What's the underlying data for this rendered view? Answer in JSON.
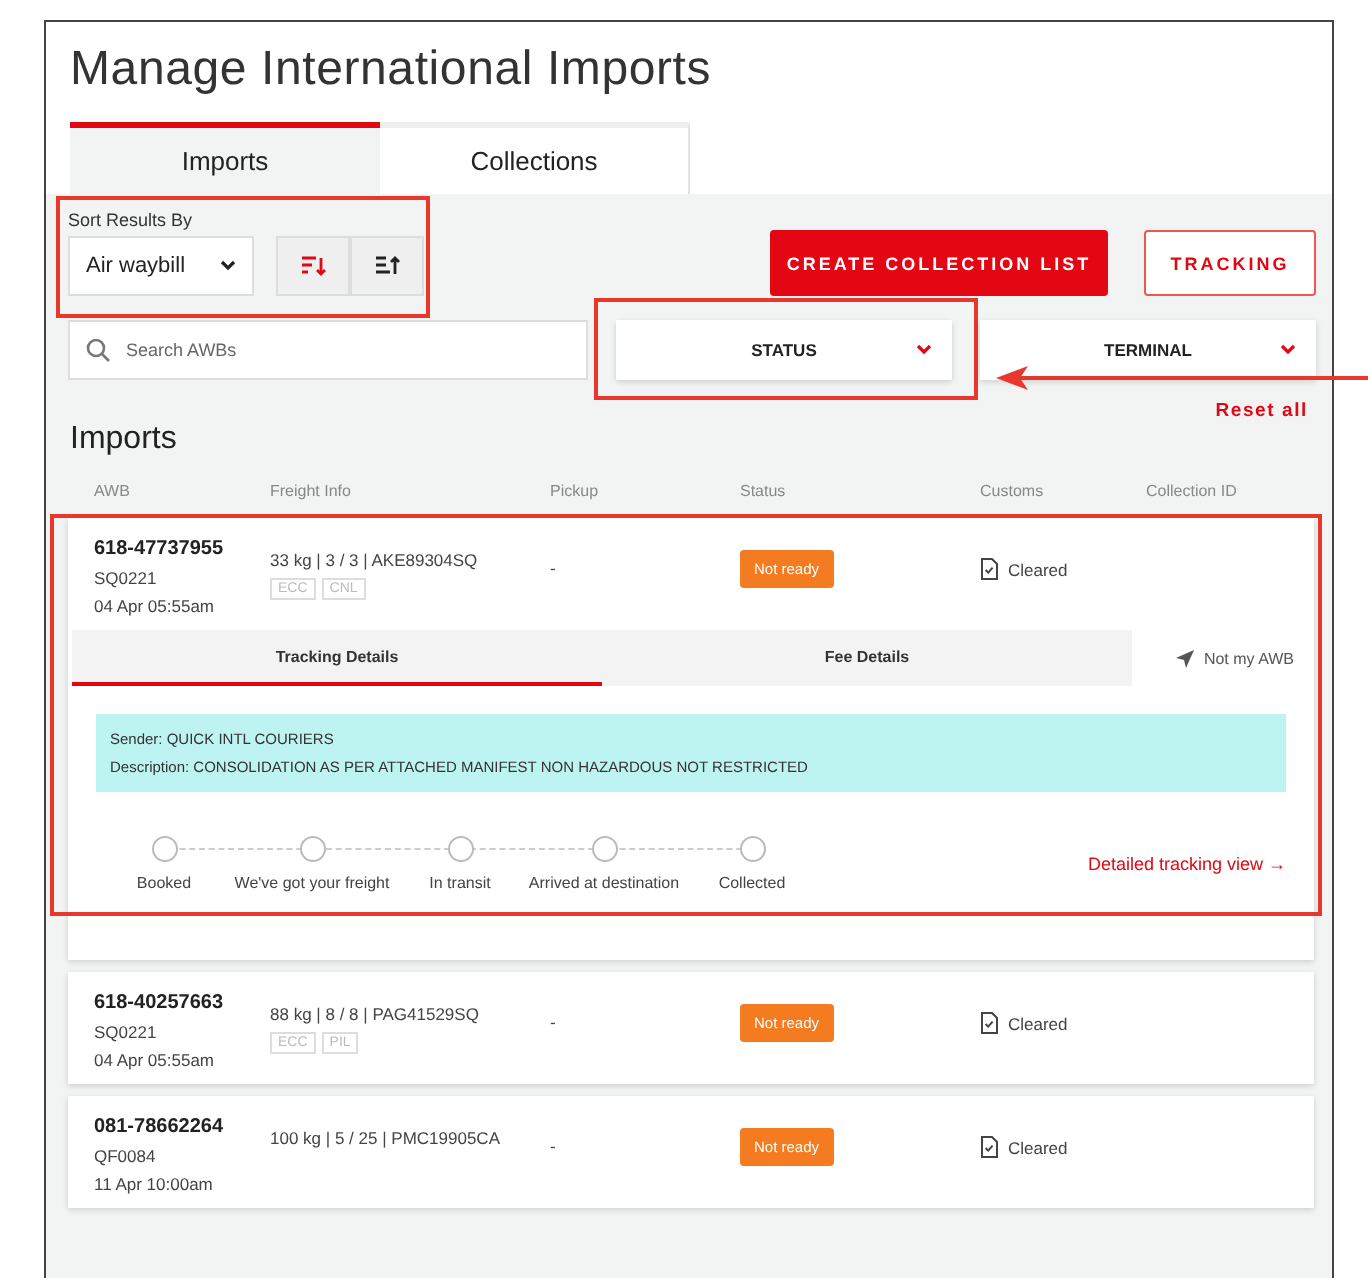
{
  "title": "Manage International Imports",
  "tabs": [
    {
      "label": "Imports",
      "selected": true
    },
    {
      "label": "Collections",
      "selected": false
    }
  ],
  "sort": {
    "label": "Sort Results By",
    "value": "Air waybill",
    "highlighted": true,
    "descending": true
  },
  "actions": [
    {
      "label": "CREATE COLLECTION LIST",
      "kind": "primary"
    },
    {
      "label": "TRACKING",
      "kind": "outline"
    }
  ],
  "search": {
    "placeholder": "Search AWBs"
  },
  "filters": [
    {
      "label": "STATUS",
      "highlighted": true
    },
    {
      "label": "TERMINAL",
      "highlighted": false
    }
  ],
  "reset": "Reset all",
  "section_title": "Imports",
  "columns": [
    "AWB",
    "Freight Info",
    "Pickup",
    "Status",
    "Customs",
    "Collection ID"
  ],
  "rows": [
    {
      "awb": "618-47737955",
      "flight": "SQ0221",
      "date": "04 Apr 05:55am",
      "freight": "33 kg | 3 / 3 | AKE89304SQ",
      "tags": [
        "ECC",
        "CNL"
      ],
      "pickup": "-",
      "status": "Not ready",
      "customs": "Cleared",
      "expanded": true,
      "highlighted": true,
      "detail_tabs": [
        {
          "label": "Tracking Details",
          "selected": true
        },
        {
          "label": "Fee Details",
          "selected": false
        }
      ],
      "not_my_awb": "Not my AWB",
      "sender": "Sender: QUICK INTL COURIERS",
      "description": "Description: CONSOLIDATION AS PER ATTACHED MANIFEST NON HAZARDOUS NOT RESTRICTED",
      "steps": [
        "Booked",
        "We've got your freight",
        "In transit",
        "Arrived at destination",
        "Collected"
      ],
      "tracking_link": "Detailed tracking view →"
    },
    {
      "awb": "618-40257663",
      "flight": "SQ0221",
      "date": "04 Apr 05:55am",
      "freight": "88 kg | 8 / 8 | PAG41529SQ",
      "tags": [
        "ECC",
        "PIL"
      ],
      "pickup": "-",
      "status": "Not ready",
      "customs": "Cleared",
      "expanded": false,
      "highlighted": false
    },
    {
      "awb": "081-78662264",
      "flight": "QF0084",
      "date": "11 Apr 10:00am",
      "freight": "100 kg | 5 / 25 | PMC19905CA",
      "tags": [],
      "pickup": "-",
      "status": "Not ready",
      "customs": "Cleared",
      "expanded": false,
      "highlighted": false
    }
  ]
}
